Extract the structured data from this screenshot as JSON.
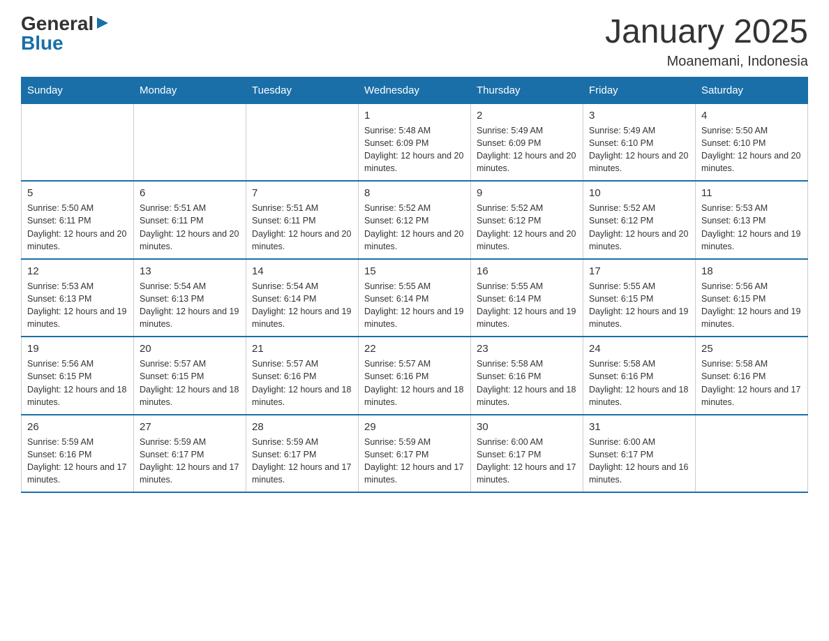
{
  "logo": {
    "general": "General",
    "arrow": "▶",
    "blue": "Blue"
  },
  "title": "January 2025",
  "subtitle": "Moanemani, Indonesia",
  "days_of_week": [
    "Sunday",
    "Monday",
    "Tuesday",
    "Wednesday",
    "Thursday",
    "Friday",
    "Saturday"
  ],
  "weeks": [
    [
      {
        "day": "",
        "info": ""
      },
      {
        "day": "",
        "info": ""
      },
      {
        "day": "",
        "info": ""
      },
      {
        "day": "1",
        "info": "Sunrise: 5:48 AM\nSunset: 6:09 PM\nDaylight: 12 hours and 20 minutes."
      },
      {
        "day": "2",
        "info": "Sunrise: 5:49 AM\nSunset: 6:09 PM\nDaylight: 12 hours and 20 minutes."
      },
      {
        "day": "3",
        "info": "Sunrise: 5:49 AM\nSunset: 6:10 PM\nDaylight: 12 hours and 20 minutes."
      },
      {
        "day": "4",
        "info": "Sunrise: 5:50 AM\nSunset: 6:10 PM\nDaylight: 12 hours and 20 minutes."
      }
    ],
    [
      {
        "day": "5",
        "info": "Sunrise: 5:50 AM\nSunset: 6:11 PM\nDaylight: 12 hours and 20 minutes."
      },
      {
        "day": "6",
        "info": "Sunrise: 5:51 AM\nSunset: 6:11 PM\nDaylight: 12 hours and 20 minutes."
      },
      {
        "day": "7",
        "info": "Sunrise: 5:51 AM\nSunset: 6:11 PM\nDaylight: 12 hours and 20 minutes."
      },
      {
        "day": "8",
        "info": "Sunrise: 5:52 AM\nSunset: 6:12 PM\nDaylight: 12 hours and 20 minutes."
      },
      {
        "day": "9",
        "info": "Sunrise: 5:52 AM\nSunset: 6:12 PM\nDaylight: 12 hours and 20 minutes."
      },
      {
        "day": "10",
        "info": "Sunrise: 5:52 AM\nSunset: 6:12 PM\nDaylight: 12 hours and 20 minutes."
      },
      {
        "day": "11",
        "info": "Sunrise: 5:53 AM\nSunset: 6:13 PM\nDaylight: 12 hours and 19 minutes."
      }
    ],
    [
      {
        "day": "12",
        "info": "Sunrise: 5:53 AM\nSunset: 6:13 PM\nDaylight: 12 hours and 19 minutes."
      },
      {
        "day": "13",
        "info": "Sunrise: 5:54 AM\nSunset: 6:13 PM\nDaylight: 12 hours and 19 minutes."
      },
      {
        "day": "14",
        "info": "Sunrise: 5:54 AM\nSunset: 6:14 PM\nDaylight: 12 hours and 19 minutes."
      },
      {
        "day": "15",
        "info": "Sunrise: 5:55 AM\nSunset: 6:14 PM\nDaylight: 12 hours and 19 minutes."
      },
      {
        "day": "16",
        "info": "Sunrise: 5:55 AM\nSunset: 6:14 PM\nDaylight: 12 hours and 19 minutes."
      },
      {
        "day": "17",
        "info": "Sunrise: 5:55 AM\nSunset: 6:15 PM\nDaylight: 12 hours and 19 minutes."
      },
      {
        "day": "18",
        "info": "Sunrise: 5:56 AM\nSunset: 6:15 PM\nDaylight: 12 hours and 19 minutes."
      }
    ],
    [
      {
        "day": "19",
        "info": "Sunrise: 5:56 AM\nSunset: 6:15 PM\nDaylight: 12 hours and 18 minutes."
      },
      {
        "day": "20",
        "info": "Sunrise: 5:57 AM\nSunset: 6:15 PM\nDaylight: 12 hours and 18 minutes."
      },
      {
        "day": "21",
        "info": "Sunrise: 5:57 AM\nSunset: 6:16 PM\nDaylight: 12 hours and 18 minutes."
      },
      {
        "day": "22",
        "info": "Sunrise: 5:57 AM\nSunset: 6:16 PM\nDaylight: 12 hours and 18 minutes."
      },
      {
        "day": "23",
        "info": "Sunrise: 5:58 AM\nSunset: 6:16 PM\nDaylight: 12 hours and 18 minutes."
      },
      {
        "day": "24",
        "info": "Sunrise: 5:58 AM\nSunset: 6:16 PM\nDaylight: 12 hours and 18 minutes."
      },
      {
        "day": "25",
        "info": "Sunrise: 5:58 AM\nSunset: 6:16 PM\nDaylight: 12 hours and 17 minutes."
      }
    ],
    [
      {
        "day": "26",
        "info": "Sunrise: 5:59 AM\nSunset: 6:16 PM\nDaylight: 12 hours and 17 minutes."
      },
      {
        "day": "27",
        "info": "Sunrise: 5:59 AM\nSunset: 6:17 PM\nDaylight: 12 hours and 17 minutes."
      },
      {
        "day": "28",
        "info": "Sunrise: 5:59 AM\nSunset: 6:17 PM\nDaylight: 12 hours and 17 minutes."
      },
      {
        "day": "29",
        "info": "Sunrise: 5:59 AM\nSunset: 6:17 PM\nDaylight: 12 hours and 17 minutes."
      },
      {
        "day": "30",
        "info": "Sunrise: 6:00 AM\nSunset: 6:17 PM\nDaylight: 12 hours and 17 minutes."
      },
      {
        "day": "31",
        "info": "Sunrise: 6:00 AM\nSunset: 6:17 PM\nDaylight: 12 hours and 16 minutes."
      },
      {
        "day": "",
        "info": ""
      }
    ]
  ]
}
